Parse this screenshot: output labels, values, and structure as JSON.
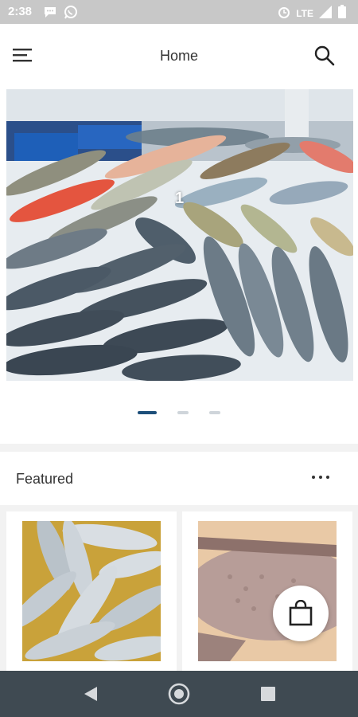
{
  "status_bar": {
    "time": "2:38",
    "network": "LTE"
  },
  "app_bar": {
    "title": "Home"
  },
  "banner": {
    "slide_number": "1",
    "dot_count": 3,
    "active_index": 0
  },
  "featured": {
    "title": "Featured"
  },
  "colors": {
    "accent": "#1d4f7a",
    "navbar": "#3f4a52",
    "statusbar": "#c8c8c8"
  }
}
